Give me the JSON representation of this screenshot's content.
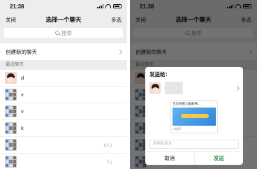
{
  "status": {
    "time": "21:38"
  },
  "nav": {
    "close": "关闭",
    "title": "选择一个聊天",
    "multi": "多选"
  },
  "search": {
    "placeholder": "搜索"
  },
  "create_chat": "创建新的聊天",
  "section_recent": "最近聊天",
  "recent_chats": [
    {
      "name": "d",
      "meta": ""
    },
    {
      "name": "v",
      "meta": ""
    },
    {
      "name": "v",
      "meta": ""
    },
    {
      "name": "k",
      "meta": ""
    },
    {
      "name": "",
      "meta": "8人)"
    },
    {
      "name": "",
      "meta": "人)"
    }
  ],
  "dialog": {
    "title": "发送给：",
    "card_title": "宝贝树婴儿眼故事...",
    "card_tag": "小程序",
    "input_placeholder": "给朋友留言",
    "cancel": "取消",
    "send": "发送"
  }
}
